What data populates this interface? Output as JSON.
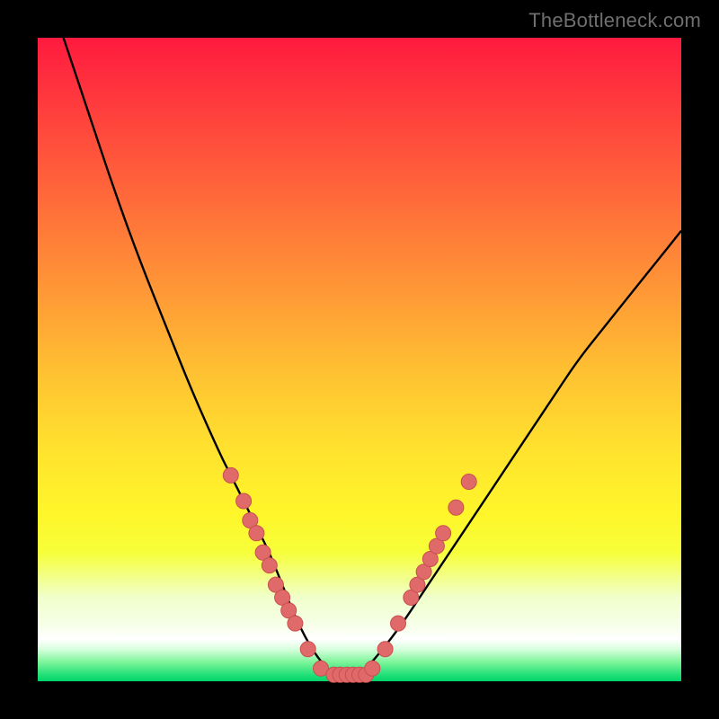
{
  "watermark": "TheBottleneck.com",
  "colors": {
    "background": "#000000",
    "curve_stroke": "#000000",
    "dot_fill": "#e06a6a",
    "dot_stroke": "#c94f4f"
  },
  "chart_data": {
    "type": "line",
    "title": "",
    "xlabel": "",
    "ylabel": "",
    "xlim": [
      0,
      100
    ],
    "ylim": [
      0,
      100
    ],
    "grid": false,
    "series": [
      {
        "name": "bottleneck-curve",
        "x": [
          4,
          8,
          12,
          16,
          20,
          24,
          28,
          30,
          32,
          34,
          36,
          38,
          40,
          42,
          44,
          46,
          48,
          50,
          52,
          56,
          60,
          64,
          68,
          72,
          76,
          80,
          84,
          88,
          92,
          96,
          100
        ],
        "y": [
          100,
          88,
          76,
          65,
          55,
          45,
          36,
          32,
          28,
          24,
          20,
          15,
          10,
          6,
          3,
          1,
          1,
          1,
          3,
          8,
          14,
          20,
          26,
          32,
          38,
          44,
          50,
          55,
          60,
          65,
          70
        ]
      }
    ],
    "annotations": {
      "dots": [
        {
          "x": 30,
          "y": 32
        },
        {
          "x": 32,
          "y": 28
        },
        {
          "x": 33,
          "y": 25
        },
        {
          "x": 34,
          "y": 23
        },
        {
          "x": 35,
          "y": 20
        },
        {
          "x": 36,
          "y": 18
        },
        {
          "x": 37,
          "y": 15
        },
        {
          "x": 38,
          "y": 13
        },
        {
          "x": 39,
          "y": 11
        },
        {
          "x": 40,
          "y": 9
        },
        {
          "x": 42,
          "y": 5
        },
        {
          "x": 44,
          "y": 2
        },
        {
          "x": 46,
          "y": 1
        },
        {
          "x": 47,
          "y": 1
        },
        {
          "x": 48,
          "y": 1
        },
        {
          "x": 49,
          "y": 1
        },
        {
          "x": 50,
          "y": 1
        },
        {
          "x": 51,
          "y": 1
        },
        {
          "x": 52,
          "y": 2
        },
        {
          "x": 54,
          "y": 5
        },
        {
          "x": 56,
          "y": 9
        },
        {
          "x": 58,
          "y": 13
        },
        {
          "x": 59,
          "y": 15
        },
        {
          "x": 60,
          "y": 17
        },
        {
          "x": 61,
          "y": 19
        },
        {
          "x": 62,
          "y": 21
        },
        {
          "x": 63,
          "y": 23
        },
        {
          "x": 65,
          "y": 27
        },
        {
          "x": 67,
          "y": 31
        }
      ]
    }
  }
}
